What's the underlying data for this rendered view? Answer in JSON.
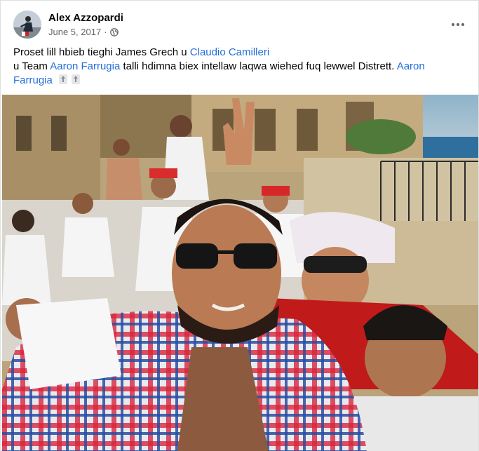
{
  "post": {
    "author": "Alex Azzopardi",
    "date": "June 5, 2017",
    "separator": "·",
    "privacy_icon": "globe-icon",
    "more_icon": "more-options-icon",
    "caption": {
      "line1_text": "Proset lill hbieb tieghi James Grech u ",
      "line1_link": "Claudio Camilleri",
      "line2_prefix": "u Team ",
      "line2_link1": "Aaron Farrugia",
      "line2_middle": " talli hdimna biex intellaw laqwa wiehed fuq lewwel Distrett. ",
      "line2_link2a": "Aaron",
      "line3_link2b": "Farrugia",
      "emoji_icon": "recycle-arrows-icon"
    },
    "photo_icon": "group-selfie-photo"
  },
  "colors": {
    "link": "#216fdb",
    "text": "#050505",
    "muted": "#65676b"
  }
}
